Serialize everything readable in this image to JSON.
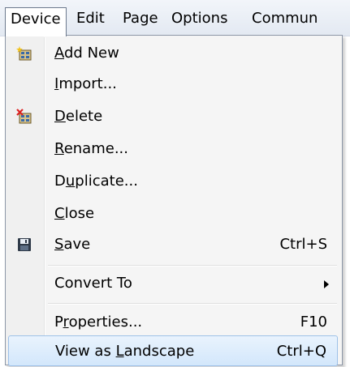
{
  "menubar": {
    "items": [
      "Device",
      "Edit",
      "Page",
      "Options",
      "Commun"
    ]
  },
  "menu": {
    "items": [
      {
        "id": "add-new",
        "before": "",
        "mnemonic": "A",
        "after": "dd New",
        "shortcut": "",
        "icon": "add-device-icon"
      },
      {
        "id": "import",
        "before": "",
        "mnemonic": "I",
        "after": "mport...",
        "shortcut": "",
        "icon": ""
      },
      {
        "id": "delete",
        "before": "",
        "mnemonic": "D",
        "after": "elete",
        "shortcut": "",
        "icon": "delete-device-icon"
      },
      {
        "id": "rename",
        "before": "",
        "mnemonic": "R",
        "after": "ename...",
        "shortcut": "",
        "icon": ""
      },
      {
        "id": "duplicate",
        "before": "D",
        "mnemonic": "u",
        "after": "plicate...",
        "shortcut": "",
        "icon": ""
      },
      {
        "id": "close",
        "before": "",
        "mnemonic": "C",
        "after": "lose",
        "shortcut": "",
        "icon": ""
      },
      {
        "id": "save",
        "before": "",
        "mnemonic": "S",
        "after": "ave",
        "shortcut": "Ctrl+S",
        "icon": "save-icon"
      },
      {
        "id": "convert-to",
        "before": "Convert To",
        "mnemonic": "",
        "after": "",
        "shortcut": "",
        "icon": "",
        "submenu": true
      },
      {
        "id": "properties",
        "before": "P",
        "mnemonic": "r",
        "after": "operties...",
        "shortcut": "F10",
        "icon": ""
      },
      {
        "id": "view-as-landscape",
        "before": "View as ",
        "mnemonic": "L",
        "after": "andscape",
        "shortcut": "Ctrl+Q",
        "icon": "",
        "highlighted": true
      }
    ]
  },
  "colors": {
    "menu_bg": "#f5f5f5",
    "highlight_border": "#9ec1e8",
    "highlight_fill": "#d3e7fb"
  }
}
